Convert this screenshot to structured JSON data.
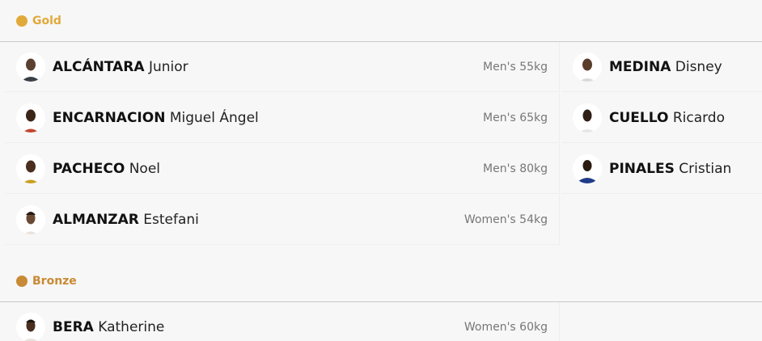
{
  "colors": {
    "gold": "#e1a93a",
    "bronze": "#c98a35"
  },
  "sections": {
    "gold": {
      "label": "Gold",
      "left": [
        {
          "last": "ALCÁNTARA",
          "first": "Junior",
          "event": "Men's 55kg"
        },
        {
          "last": "ENCARNACION",
          "first": "Miguel Ángel",
          "event": "Men's 65kg"
        },
        {
          "last": "PACHECO",
          "first": "Noel",
          "event": "Men's 80kg"
        },
        {
          "last": "ALMANZAR",
          "first": "Estefani",
          "event": "Women's 54kg"
        }
      ],
      "right": [
        {
          "last": "MEDINA",
          "first": "Disney"
        },
        {
          "last": "CUELLO",
          "first": "Ricardo"
        },
        {
          "last": "PINALES",
          "first": "Cristian"
        }
      ]
    },
    "bronze": {
      "label": "Bronze",
      "left": [
        {
          "last": "BERA",
          "first": "Katherine",
          "event": "Women's 60kg"
        }
      ]
    }
  }
}
